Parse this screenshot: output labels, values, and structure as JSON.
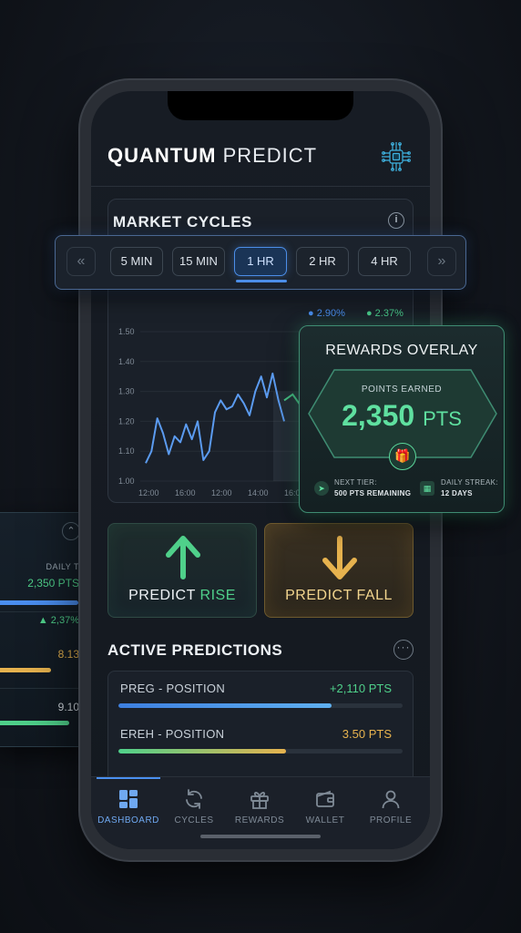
{
  "app": {
    "title_bold": "QUANTUM",
    "title_light": "PREDICT"
  },
  "market": {
    "title": "MARKET CYCLES",
    "timeframes": [
      "5 MIN",
      "15 MIN",
      "1 HR",
      "2 HR",
      "4 HR"
    ],
    "selected_timeframe": "1 HR",
    "prev_arrow": "«",
    "next_arrow": "»",
    "legend": [
      {
        "label": "2.90%",
        "color": "#4a8ef0"
      },
      {
        "label": "2.37%",
        "color": "#49c98a"
      }
    ]
  },
  "chart_data": {
    "type": "line",
    "x": [
      "12:00",
      "16:00",
      "12:00",
      "14:00",
      "16:00"
    ],
    "yticks": [
      "1.50",
      "1.40",
      "1.30",
      "1.20",
      "1.10",
      "1.00"
    ],
    "ylim": [
      1.0,
      1.5
    ],
    "series": [
      {
        "color": "#5b9bf0",
        "values": [
          1.06,
          1.1,
          1.21,
          1.16,
          1.09,
          1.15,
          1.13,
          1.19,
          1.14,
          1.2,
          1.07,
          1.1,
          1.23,
          1.27,
          1.24,
          1.25,
          1.29,
          1.26,
          1.22,
          1.3,
          1.35,
          1.28,
          1.36,
          1.27,
          1.2
        ]
      },
      {
        "color": "#49c98a",
        "values": [
          1.27,
          1.29,
          1.25,
          1.27
        ]
      }
    ]
  },
  "actions": {
    "rise_prefix": "PREDICT ",
    "rise_word": "RISE",
    "fall_prefix": "PREDICT FALL"
  },
  "active": {
    "title": "ACTIVE PREDICTIONS",
    "positions": [
      {
        "name": "PREG - POSITION",
        "value": "+2,110 PTS",
        "color": "#4fd08a",
        "progress": 0.75
      },
      {
        "name": "EREH - POSITION",
        "value": "3.50 PTS",
        "color": "#e6b24e",
        "progress": 0.59
      }
    ]
  },
  "rewards": {
    "title": "REWARDS OVERLAY",
    "label": "POINTS EARNED",
    "points": "2,350",
    "unit": "PTS",
    "next_tier_label": "NEXT TIER:",
    "next_tier_value": "500 PTS REMAINING",
    "streak_label": "DAILY STREAK:",
    "streak_value": "12 DAYS"
  },
  "side_card": {
    "label": "DAILY T",
    "points": "2,350 PTS",
    "change": "▲ 2,37%",
    "val1": "8.13",
    "val2": "9.10"
  },
  "tabs": [
    {
      "label": "DASHBOARD",
      "icon": "dashboard-icon",
      "active": true
    },
    {
      "label": "CYCLES",
      "icon": "cycles-icon",
      "active": false
    },
    {
      "label": "REWARDS",
      "icon": "gift-icon",
      "active": false
    },
    {
      "label": "WALLET",
      "icon": "wallet-icon",
      "active": false
    },
    {
      "label": "PROFILE",
      "icon": "profile-icon",
      "active": false
    }
  ]
}
